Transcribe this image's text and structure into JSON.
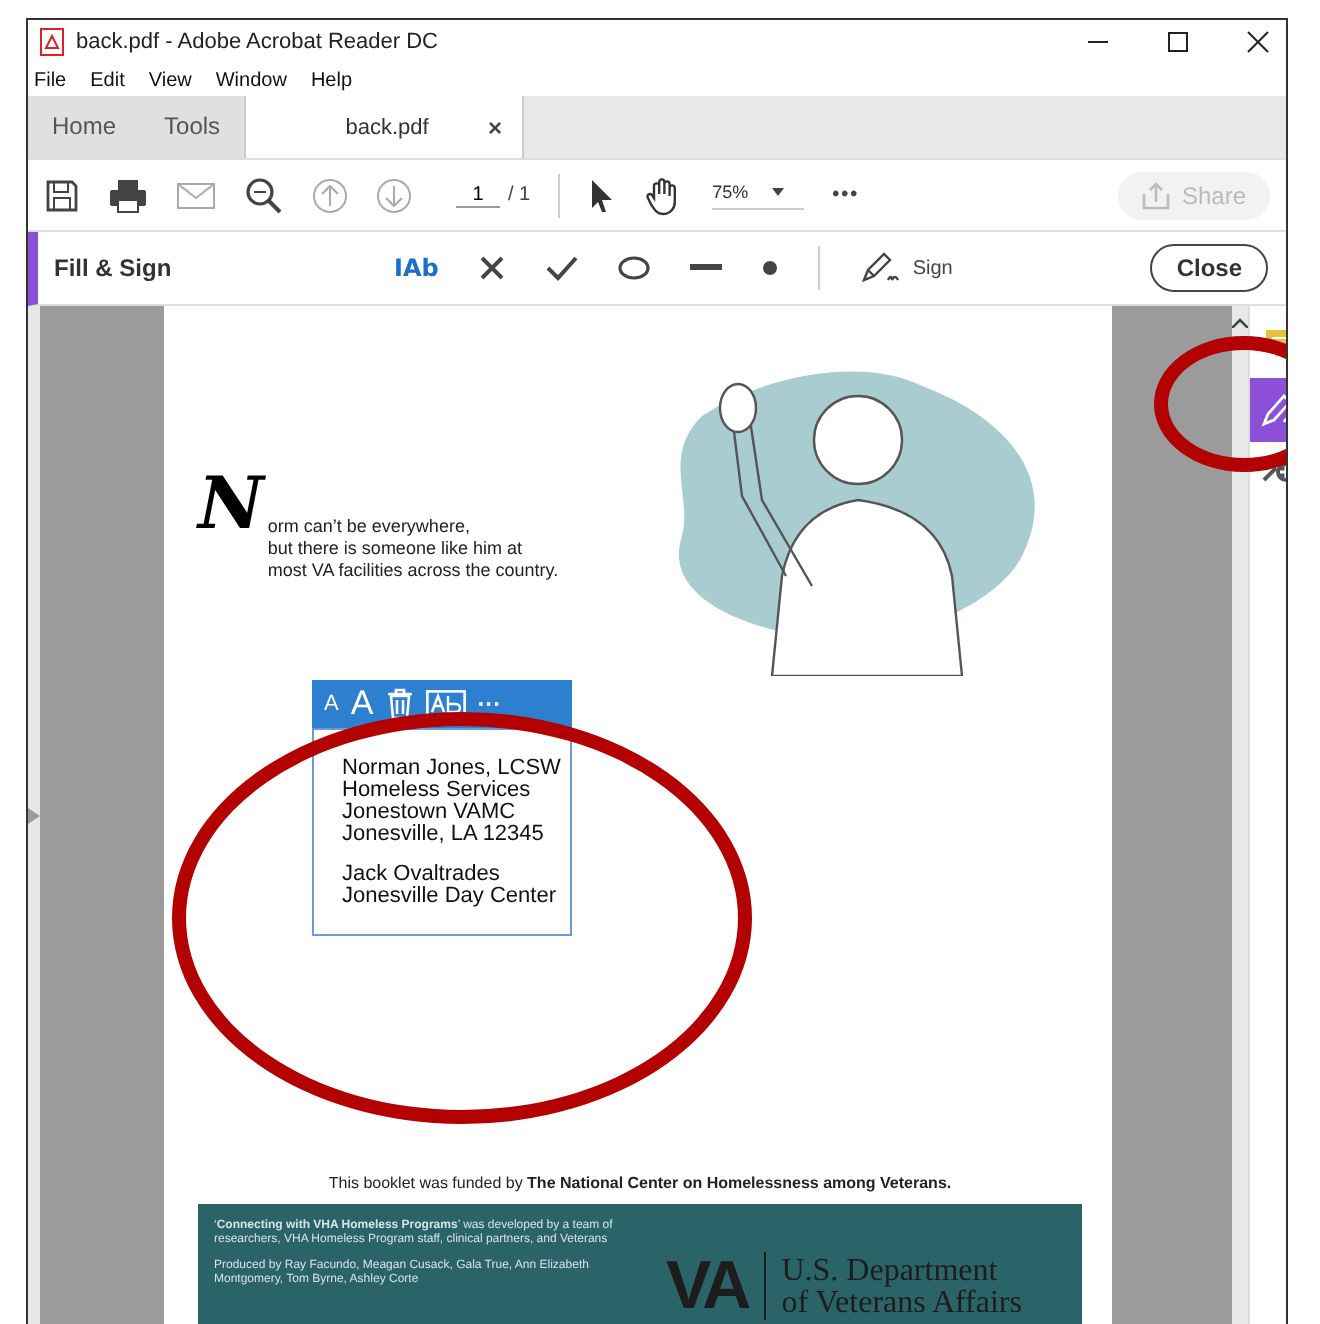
{
  "window": {
    "title": "back.pdf - Adobe Acrobat Reader DC"
  },
  "menu": [
    "File",
    "Edit",
    "View",
    "Window",
    "Help"
  ],
  "tabs": [
    {
      "label": "Home",
      "kind": "nav",
      "selected": false
    },
    {
      "label": "Tools",
      "kind": "nav",
      "selected": false
    },
    {
      "label": "back.pdf",
      "kind": "doc",
      "selected": true
    }
  ],
  "tab_close": "×",
  "toolbar": {
    "page": "1",
    "page_total": "/ 1",
    "zoom": "75%",
    "more": "•••",
    "share": {
      "label": "Share",
      "disabled": true
    }
  },
  "fill_sign": {
    "title": "Fill & Sign",
    "tools": [
      {
        "kind": "text",
        "label": "IAb",
        "selected": true
      },
      {
        "kind": "cross",
        "selected": false
      },
      {
        "kind": "check",
        "selected": false
      },
      {
        "kind": "ellipse",
        "selected": false
      },
      {
        "kind": "line",
        "selected": false
      },
      {
        "kind": "dot",
        "selected": false
      }
    ],
    "sign": "Sign",
    "close": "Close"
  },
  "document": {
    "initial": "N",
    "intro": [
      "orm can’t be everywhere,",
      "but there is someone like him at",
      "most VA facilities across the country."
    ],
    "text_box": {
      "toolbar": [
        {
          "kind": "small-text",
          "label": "A"
        },
        {
          "kind": "large-text",
          "label": "A"
        },
        {
          "kind": "delete"
        },
        {
          "kind": "field"
        },
        {
          "kind": "more",
          "label": "···"
        }
      ],
      "paragraphs": [
        [
          "Norman Jones, LCSW",
          "Homeless Services",
          "Jonestown VAMC",
          "Jonesville, LA 12345"
        ],
        [
          "Jack Ovaltrades",
          "Jonesville Day Center"
        ]
      ]
    },
    "funding": "This booklet was funded by **The National Center on Homelessness among Veterans.**",
    "banner": {
      "credits": [
        "‘**Connecting with VHA Homeless Programs**’ was developed by a team of researchers, VHA Homeless Program staff, clinical partners, and Veterans",
        "Produced by Ray Facundo, Meagan Cusack, Gala True, Ann Elizabeth Montgomery, Tom Byrne, Ashley Corte"
      ],
      "logo": "VA",
      "department": [
        "U.S. Department",
        "of Veterans Affairs"
      ]
    }
  },
  "annotations": [
    {
      "kind": "circle"
    },
    {
      "kind": "circle"
    }
  ]
}
